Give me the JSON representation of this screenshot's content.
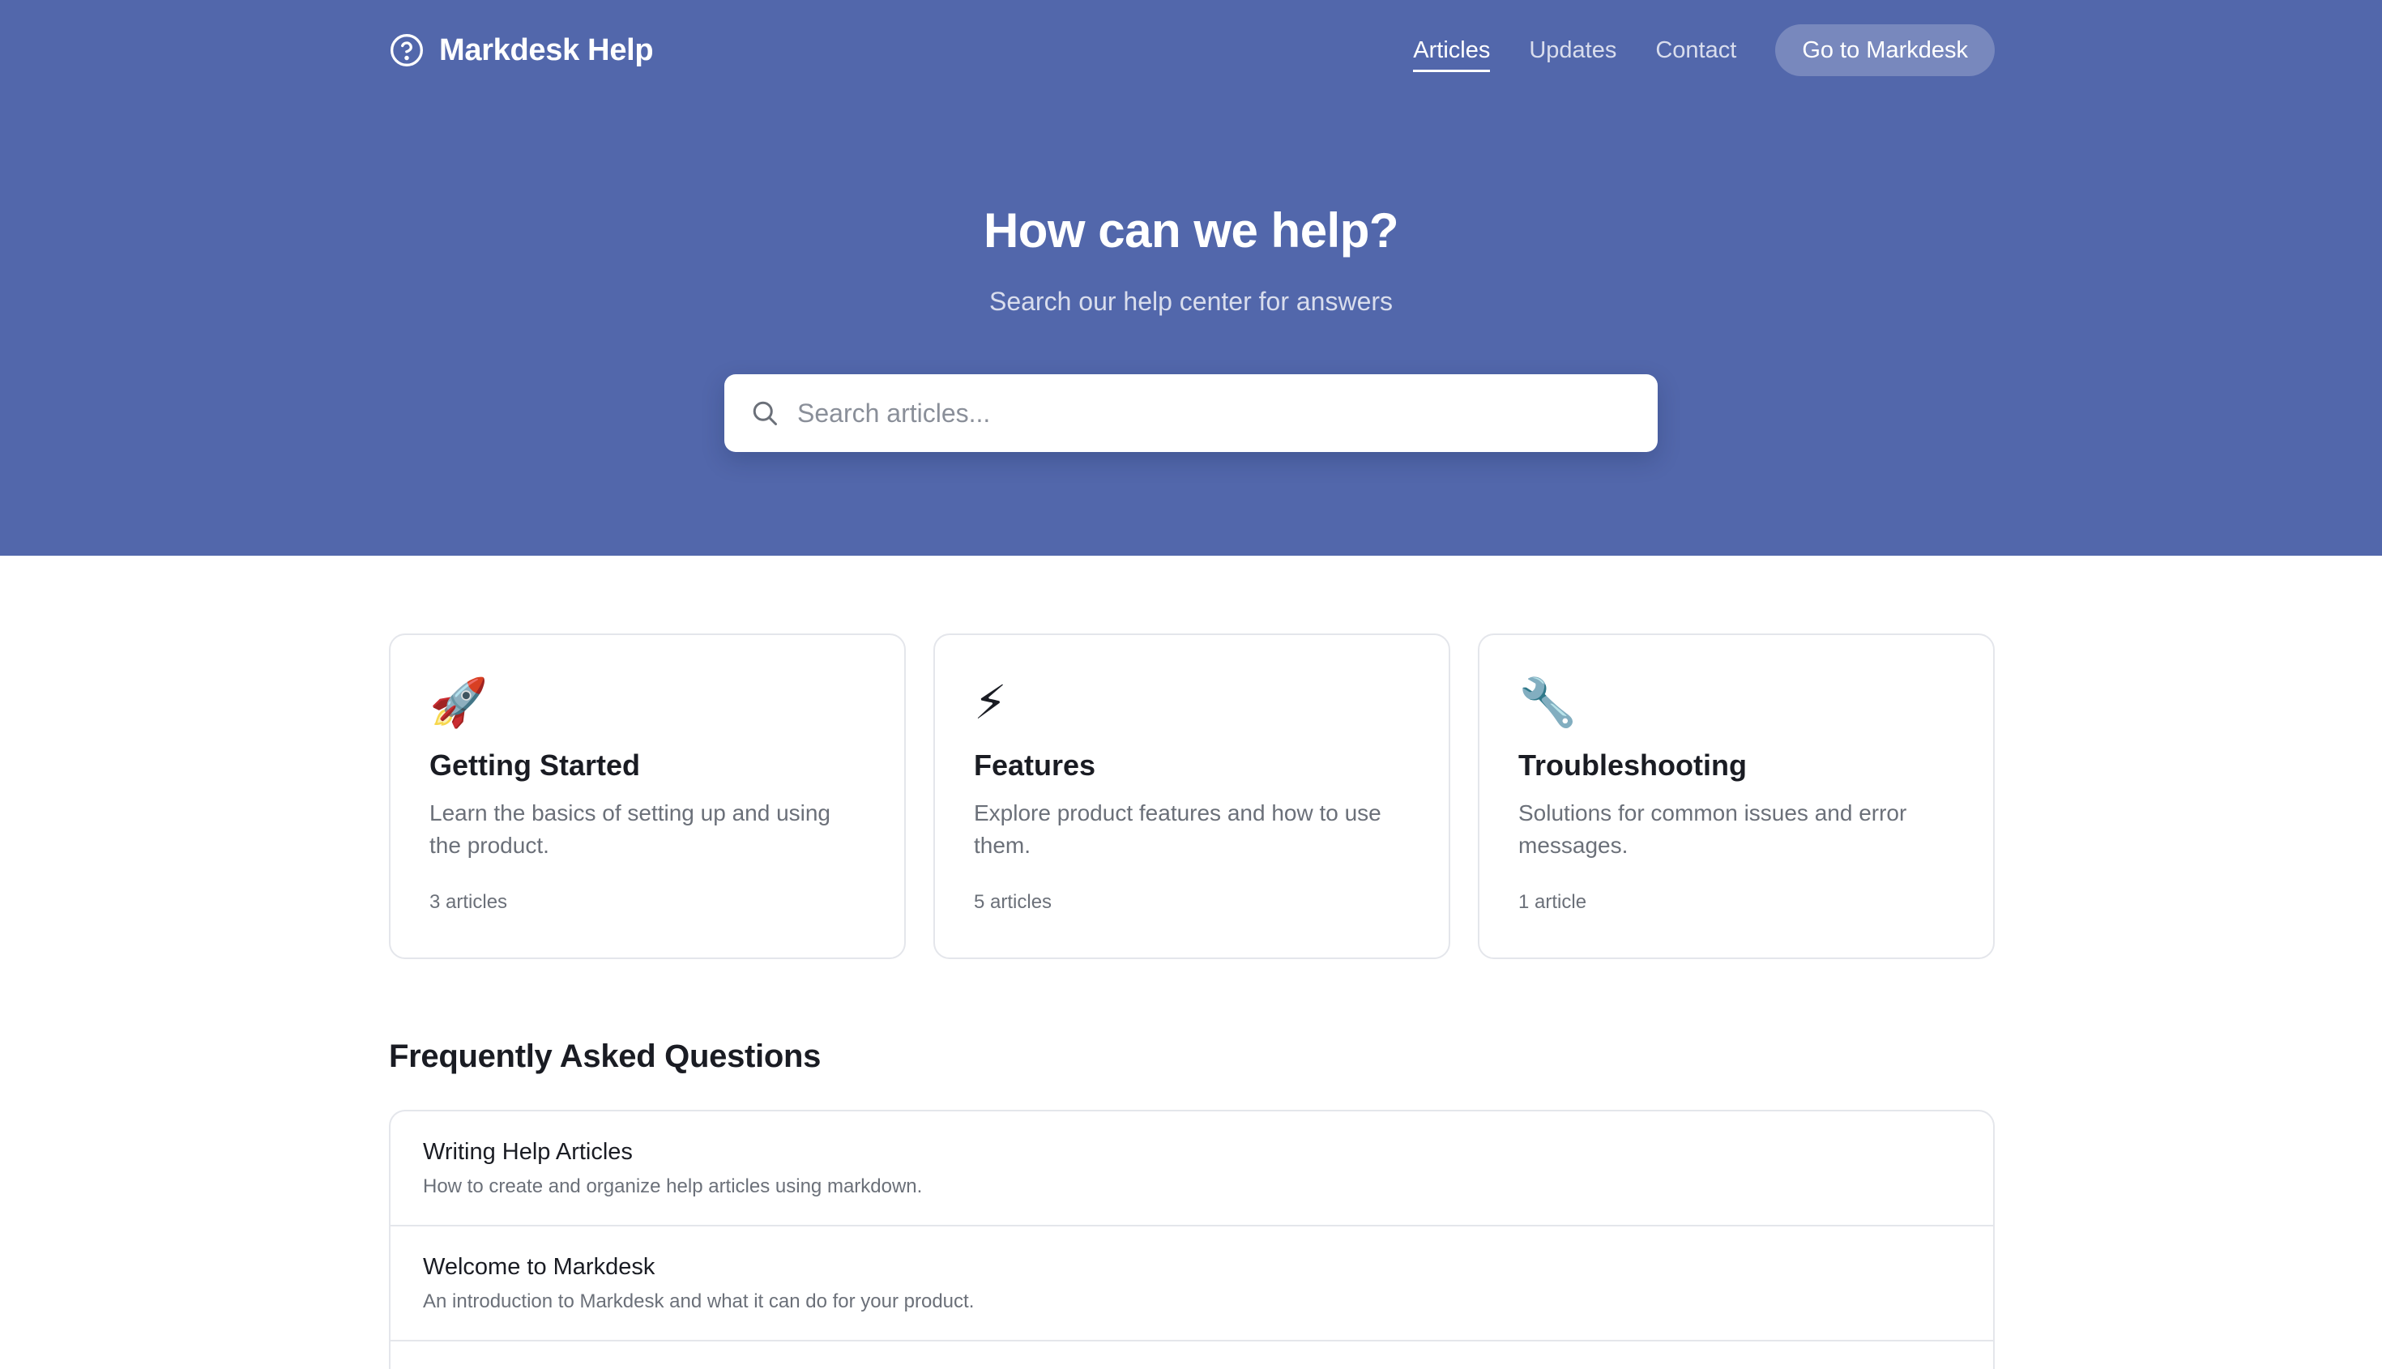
{
  "header": {
    "brand": "Markdesk Help",
    "brand_icon": "question-circle-icon",
    "nav": [
      {
        "label": "Articles",
        "active": true
      },
      {
        "label": "Updates",
        "active": false
      },
      {
        "label": "Contact",
        "active": false
      }
    ],
    "cta_label": "Go to Markdesk"
  },
  "hero": {
    "title": "How can we help?",
    "subtitle": "Search our help center for answers",
    "search_placeholder": "Search articles...",
    "search_icon": "search-icon",
    "background_color": "#5267ab"
  },
  "categories": [
    {
      "icon": "rocket-icon",
      "glyph": "🚀",
      "title": "Getting Started",
      "description": "Learn the basics of setting up and using the product.",
      "count": "3 articles"
    },
    {
      "icon": "lightning-icon",
      "glyph": "⚡",
      "title": "Features",
      "description": "Explore product features and how to use them.",
      "count": "5 articles"
    },
    {
      "icon": "wrench-icon",
      "glyph": "🔧",
      "title": "Troubleshooting",
      "description": "Solutions for common issues and error messages.",
      "count": "1 article"
    }
  ],
  "faq": {
    "title": "Frequently Asked Questions",
    "items": [
      {
        "title": "Writing Help Articles",
        "description": "How to create and organize help articles using markdown."
      },
      {
        "title": "Welcome to Markdesk",
        "description": "An introduction to Markdesk and what it can do for your product."
      }
    ]
  }
}
